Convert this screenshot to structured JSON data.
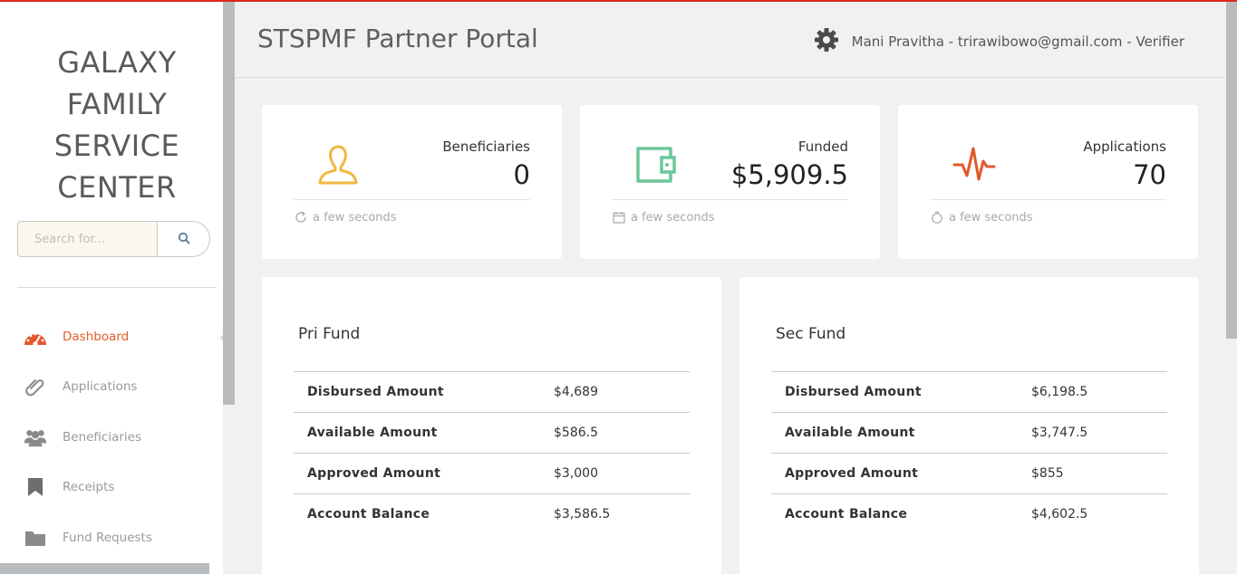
{
  "sidebar": {
    "brand_lines": [
      "GALAXY",
      "FAMILY",
      "SERVICE",
      "CENTER"
    ],
    "search_placeholder": "Search for...",
    "search_icon": "search-icon",
    "items": [
      {
        "label": "Dashboard",
        "icon": "dashboard-gauge-icon",
        "active": true
      },
      {
        "label": "Applications",
        "icon": "paperclip-icon",
        "active": false
      },
      {
        "label": "Beneficiaries",
        "icon": "users-icon",
        "active": false
      },
      {
        "label": "Receipts",
        "icon": "bookmark-icon",
        "active": false
      },
      {
        "label": "Fund Requests",
        "icon": "folder-icon",
        "active": false
      }
    ]
  },
  "header": {
    "title": "STSPMF Partner Portal",
    "settings_icon": "gear-icon",
    "user_info": "Mani Pravitha - trirawibowo@gmail.com - Verifier"
  },
  "stats": [
    {
      "label": "Beneficiaries",
      "value": "0",
      "icon": "user-icon",
      "foot_icon": "refresh-icon",
      "foot": "a few seconds",
      "color": "#f0b840"
    },
    {
      "label": "Funded",
      "value": "$5,909.5",
      "icon": "wallet-icon",
      "foot_icon": "calendar-icon",
      "foot": "a few seconds",
      "color": "#6cc79a"
    },
    {
      "label": "Applications",
      "value": "70",
      "icon": "pulse-icon",
      "foot_icon": "stopwatch-icon",
      "foot": "a few seconds",
      "color": "#e3572a"
    }
  ],
  "funds": [
    {
      "title": "Pri Fund",
      "rows": [
        {
          "key": "Disbursed Amount",
          "value": "$4,689"
        },
        {
          "key": "Available Amount",
          "value": "$586.5"
        },
        {
          "key": "Approved Amount",
          "value": "$3,000"
        },
        {
          "key": "Account Balance",
          "value": "$3,586.5"
        }
      ]
    },
    {
      "title": "Sec Fund",
      "rows": [
        {
          "key": "Disbursed Amount",
          "value": "$6,198.5"
        },
        {
          "key": "Available Amount",
          "value": "$3,747.5"
        },
        {
          "key": "Approved Amount",
          "value": "$855"
        },
        {
          "key": "Account Balance",
          "value": "$4,602.5"
        }
      ]
    }
  ],
  "colors": {
    "accent": "#e35d2a",
    "top_bar": "#d9281f"
  }
}
